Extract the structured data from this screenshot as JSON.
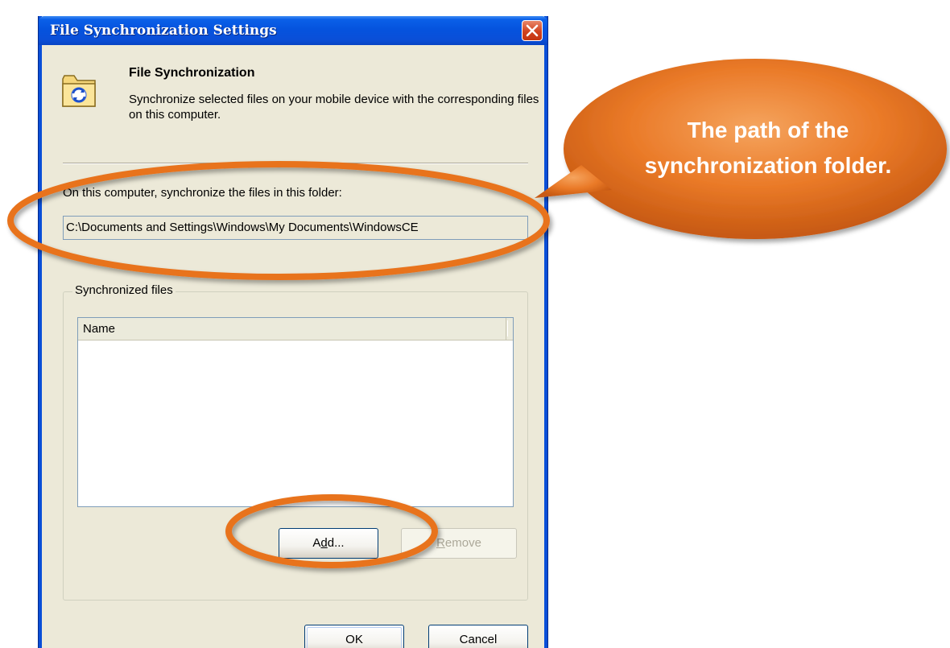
{
  "window": {
    "title": "File Synchronization Settings"
  },
  "header": {
    "title": "File Synchronization",
    "description": "Synchronize selected files on your mobile device with the corresponding files on this computer."
  },
  "folder": {
    "label": "On this computer, synchronize the files in this folder:",
    "path": "C:\\Documents and Settings\\Windows\\My Documents\\WindowsCE"
  },
  "synchronized_files": {
    "legend": "Synchronized files",
    "columns": [
      "Name"
    ],
    "rows": []
  },
  "buttons": {
    "add_pre": "A",
    "add_mnemonic": "d",
    "add_post": "d...",
    "remove_mnemonic": "R",
    "remove_post": "emove",
    "ok": "OK",
    "cancel": "Cancel"
  },
  "annotation": {
    "callout_text": "The path of the synchronization folder.",
    "color": "#e8731f"
  }
}
